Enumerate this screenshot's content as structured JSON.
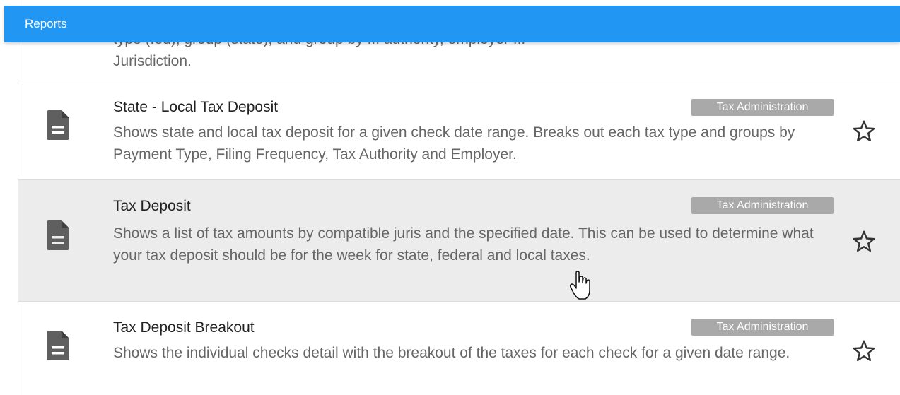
{
  "header": {
    "title": "Reports"
  },
  "partial_row": {
    "desc_line1": "type (fed), group (state), and group by ... authority, employer ...",
    "desc_line2": "Jurisdiction."
  },
  "rows": [
    {
      "name": "State - Local Tax Deposit",
      "category": "Tax Administration",
      "desc": "Shows state and local tax deposit for a given check date range. Breaks out each tax type and groups by Payment Type, Filing Frequency, Tax Authority and Employer."
    },
    {
      "name": "Tax Deposit",
      "category": "Tax Administration",
      "desc": "Shows a list of tax amounts by compatible juris and the specified date. This can be used to determine what your tax deposit should be for the week for state, federal and local taxes."
    },
    {
      "name": "Tax Deposit Breakout",
      "category": "Tax Administration",
      "desc": "Shows the individual checks detail with the breakout of the taxes for each check for a given date range."
    }
  ],
  "icons": {
    "report": "document-icon",
    "favorite": "star-outline-icon",
    "cursor": "hand-pointer-cursor"
  },
  "colors": {
    "header": "#2196F3",
    "tag": "#a9a9a9",
    "hover_row": "#ececec"
  }
}
